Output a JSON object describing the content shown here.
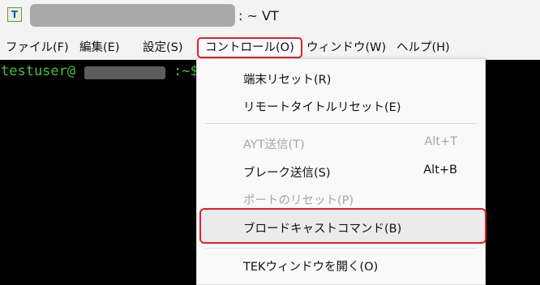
{
  "window": {
    "icon_letter": "T",
    "title_suffix": ": ~ VT"
  },
  "menubar": {
    "items": [
      {
        "label": "ファイル(F)"
      },
      {
        "label": "編集(E)"
      },
      {
        "label": "設定(S)"
      },
      {
        "label": "コントロール(O)"
      },
      {
        "label": "ウィンドウ(W)"
      },
      {
        "label": "ヘルプ(H)"
      }
    ]
  },
  "terminal": {
    "prompt_user": "testuser@",
    "prompt_tail": ":~$"
  },
  "control_menu": {
    "items": [
      {
        "label": "端末リセット(R)",
        "shortcut": "",
        "enabled": true
      },
      {
        "label": "リモートタイトルリセット(E)",
        "shortcut": "",
        "enabled": true
      },
      {
        "label": "AYT送信(T)",
        "shortcut": "Alt+T",
        "enabled": false
      },
      {
        "label": "ブレーク送信(S)",
        "shortcut": "Alt+B",
        "enabled": true
      },
      {
        "label": "ポートのリセット(P)",
        "shortcut": "",
        "enabled": false
      },
      {
        "label": "ブロードキャストコマンド(B)",
        "shortcut": "",
        "enabled": true,
        "highlighted": true
      },
      {
        "label": "TEKウィンドウを開く(O)",
        "shortcut": "",
        "enabled": true
      }
    ]
  },
  "colors": {
    "highlight_border": "#e0202a",
    "terminal_text": "#46c046"
  }
}
